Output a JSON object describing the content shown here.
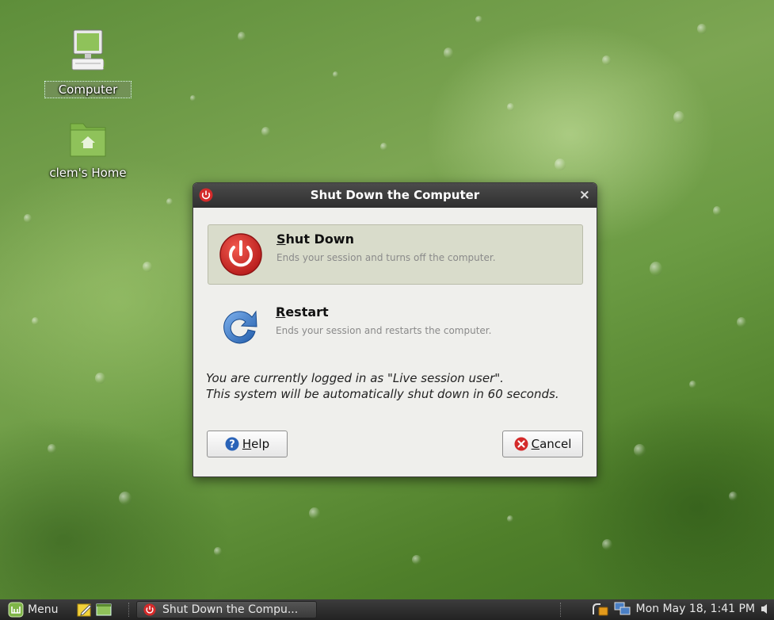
{
  "desktop": {
    "icons": [
      {
        "label": "Computer"
      },
      {
        "label": "clem's Home"
      }
    ]
  },
  "dialog": {
    "title": "Shut Down the Computer",
    "close_symbol": "×",
    "options": [
      {
        "mnemonic": "S",
        "rest": "hut Down",
        "description": "Ends your session and turns off the computer.",
        "icon": "power-icon"
      },
      {
        "mnemonic": "R",
        "rest": "estart",
        "description": "Ends your session and restarts the computer.",
        "icon": "restart-icon"
      }
    ],
    "message_line1": "You are currently logged in as \"Live session user\".",
    "message_line2": "This system will be automatically shut down in 60 seconds.",
    "help_mnemonic": "H",
    "help_rest": "elp",
    "cancel_mnemonic": "C",
    "cancel_rest": "ancel"
  },
  "taskbar": {
    "menu_label": "Menu",
    "task_label": "Shut Down the Compu...",
    "clock": "Mon May 18,  1:41 PM"
  },
  "colors": {
    "accent_red": "#d42a2a",
    "restart_blue": "#2f6fc1",
    "help_blue": "#2a63b8"
  }
}
